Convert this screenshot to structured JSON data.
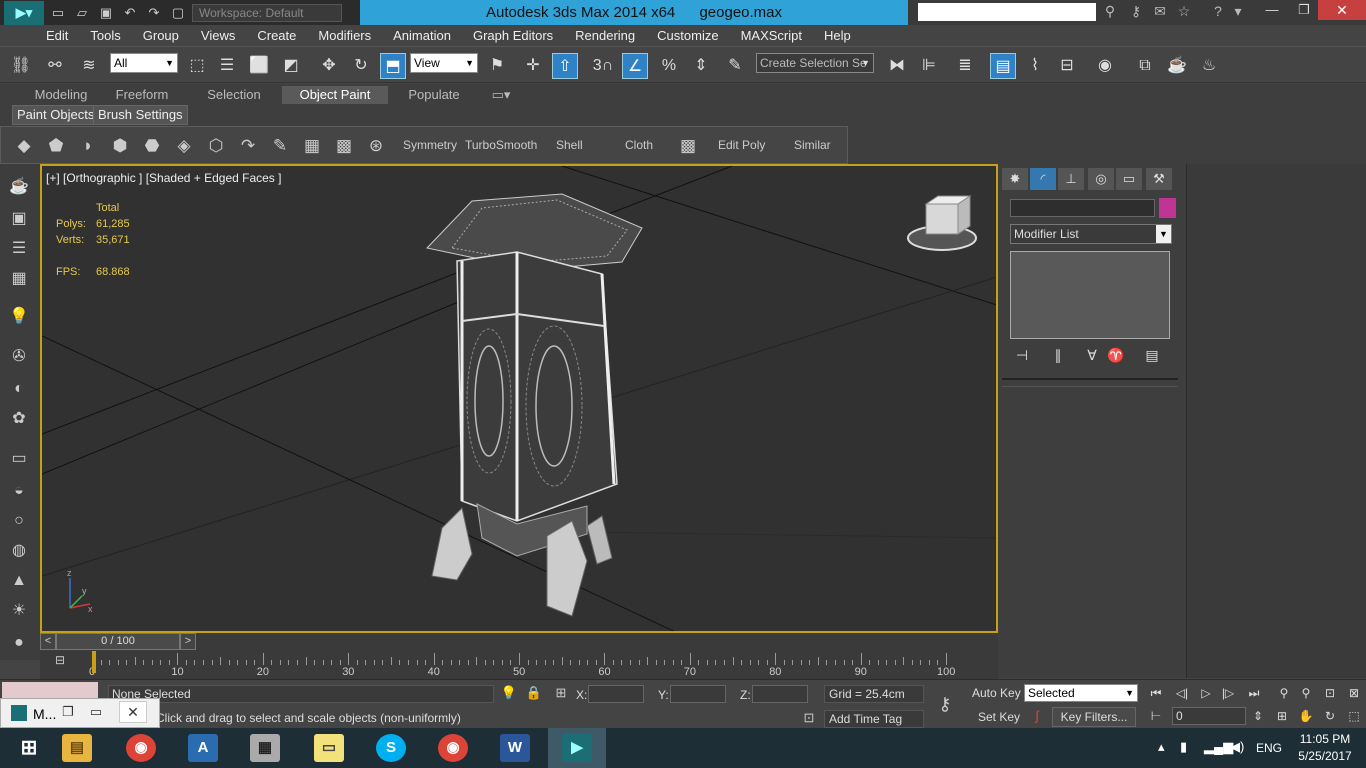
{
  "title_bar": {
    "workspace_label": "Workspace: Default",
    "app_title": "Autodesk 3ds Max  2014 x64",
    "file_name": "geogeo.max",
    "search_placeholder": ""
  },
  "menu": [
    "Edit",
    "Tools",
    "Group",
    "Views",
    "Create",
    "Modifiers",
    "Animation",
    "Graph Editors",
    "Rendering",
    "Customize",
    "MAXScript",
    "Help"
  ],
  "main_toolbar": {
    "selection_filter": "All",
    "ref_coord": "View",
    "snap_value": "3",
    "named_selection": "Create Selection Se"
  },
  "ribbon": {
    "tabs": [
      "Modeling",
      "Freeform",
      "Selection",
      "Object Paint",
      "Populate"
    ],
    "active_tab": "Object Paint",
    "subtabs": [
      "Paint Objects",
      "Brush Settings"
    ],
    "panel_labels": [
      "Symmetry",
      "TurboSmooth",
      "Shell",
      "Cloth",
      "Edit Poly",
      "Similar"
    ]
  },
  "viewport": {
    "label": "[+] [Orthographic ] [Shaded + Edged Faces ]",
    "stats_header": "Total",
    "polys_label": "Polys:",
    "polys_value": "61,285",
    "verts_label": "Verts:",
    "verts_value": "35,671",
    "fps_label": "FPS:",
    "fps_value": "68.868",
    "axis_labels": [
      "z",
      "x",
      "y"
    ]
  },
  "command_panel": {
    "modifier_list": "Modifier List",
    "object_color": "#c03494"
  },
  "time_slider": {
    "position": "0 / 100",
    "current_frame_fraction": 0.0
  },
  "track_bar": {
    "labels": [
      "0",
      "10",
      "20",
      "30",
      "40",
      "50",
      "60",
      "70",
      "80",
      "90",
      "100"
    ]
  },
  "status": {
    "selection": "None Selected",
    "prompt": "Click and drag to select and scale objects (non-uniformly)",
    "x_label": "X:",
    "y_label": "Y:",
    "z_label": "Z:",
    "grid": "Grid = 25.4cm",
    "add_time_tag": "Add Time Tag",
    "auto_key": "Auto Key",
    "set_key": "Set Key",
    "key_mode": "Selected",
    "key_filters": "Key Filters...",
    "frame": "0"
  },
  "preview": {
    "title": "M..."
  },
  "taskbar": {
    "language": "ENG",
    "time": "11:05 PM",
    "date": "5/25/2017"
  }
}
